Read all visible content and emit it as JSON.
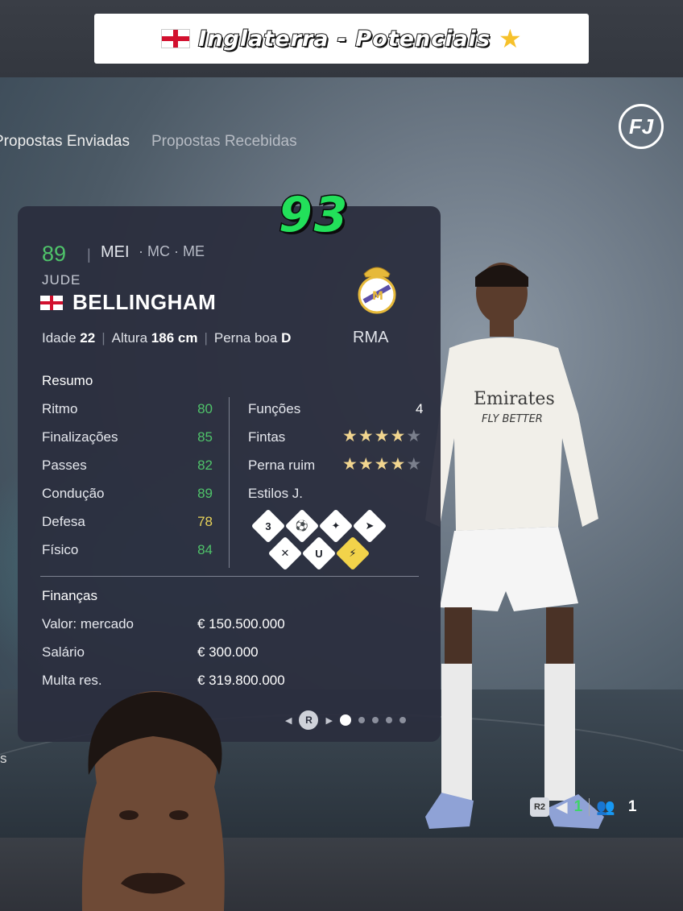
{
  "banner": {
    "title": "Inglaterra - Potenciais"
  },
  "tabs": [
    {
      "label": "Propostas Enviadas"
    },
    {
      "label": "Propostas Recebidas"
    }
  ],
  "potential_rating": "93",
  "player": {
    "overall": "89",
    "position_main": "MEI",
    "position_alt": "· MC · ME",
    "first_name": "JUDE",
    "last_name": "BELLINGHAM",
    "club": "RMA",
    "bio": {
      "age_label": "Idade",
      "age": "22",
      "height_label": "Altura",
      "height": "186 cm",
      "foot_label": "Perna boa",
      "foot": "D"
    }
  },
  "summary": {
    "label": "Resumo",
    "stats": [
      {
        "name": "Ritmo",
        "value": "80"
      },
      {
        "name": "Finalizações",
        "value": "85"
      },
      {
        "name": "Passes",
        "value": "82"
      },
      {
        "name": "Condução",
        "value": "89"
      },
      {
        "name": "Defesa",
        "value": "78"
      },
      {
        "name": "Físico",
        "value": "84"
      }
    ],
    "roles_label": "Funções",
    "roles_value": "4",
    "skill_moves_label": "Fintas",
    "skill_moves_stars": 4,
    "weak_foot_label": "Perna ruim",
    "weak_foot_stars": 4,
    "playstyles_label": "Estilos J."
  },
  "finances": {
    "label": "Finanças",
    "rows": [
      {
        "name": "Valor: mercado",
        "value": "€ 150.500.000"
      },
      {
        "name": "Salário",
        "value": "€ 300.000"
      },
      {
        "name": "Multa res.",
        "value": "€ 319.800.000"
      }
    ]
  },
  "pager": {
    "button": "R"
  },
  "hud": {
    "r2": "R2",
    "count1": "1",
    "count2": "1"
  },
  "colors": {
    "green_stat": "#4fc36a",
    "yellow_stat": "#e8d35a",
    "card_bg": "#2a2e3e",
    "rating_green": "#22e05a"
  }
}
